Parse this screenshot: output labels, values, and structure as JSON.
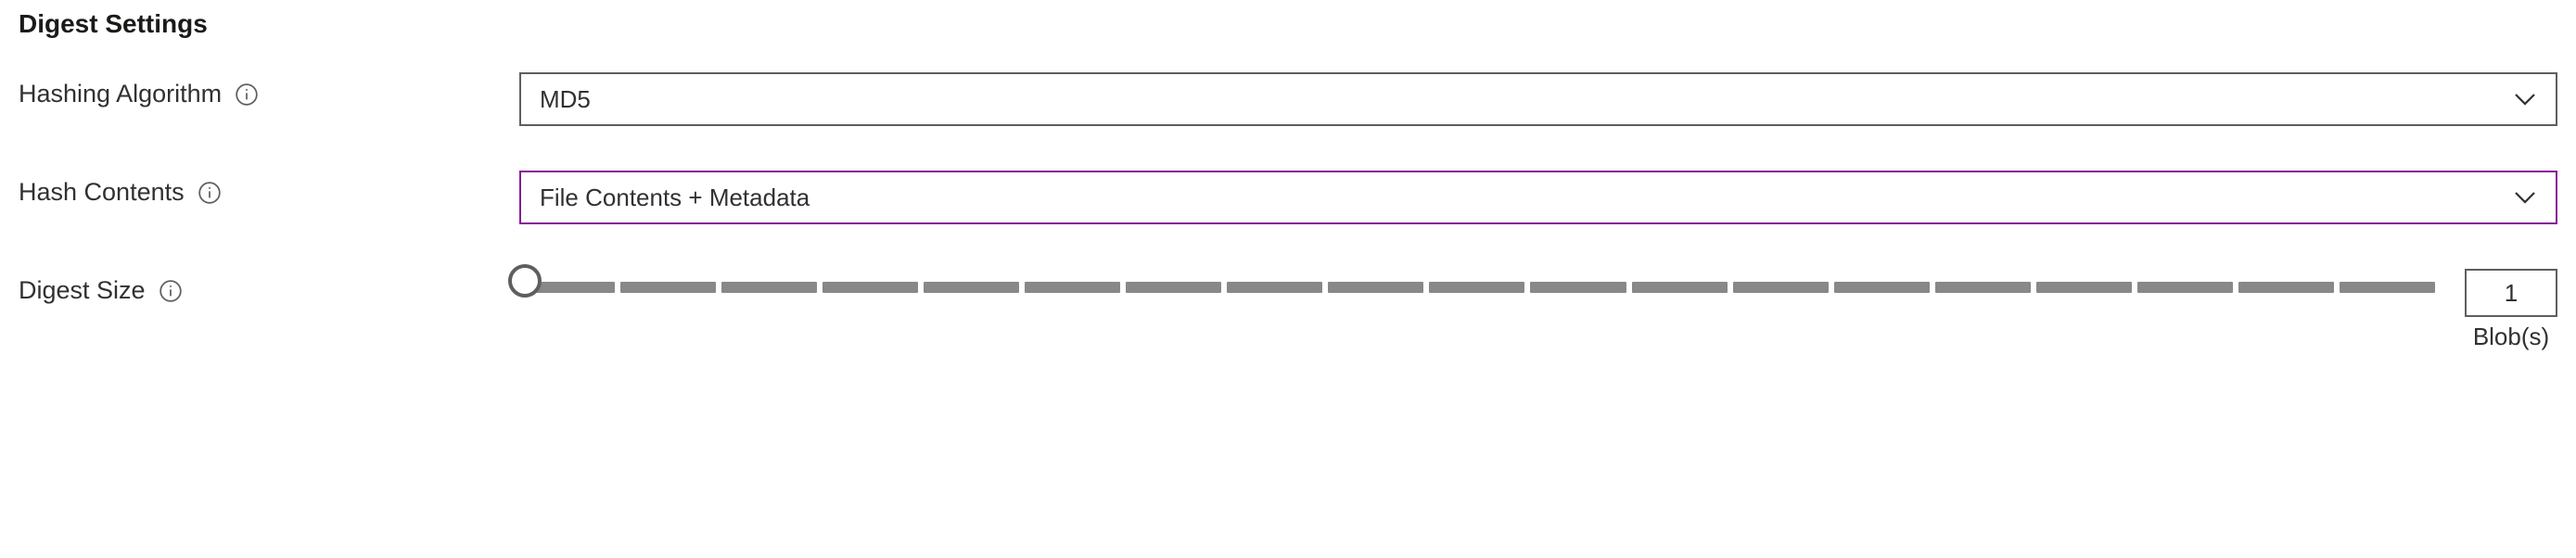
{
  "section": {
    "title": "Digest Settings"
  },
  "fields": {
    "hashingAlgorithm": {
      "label": "Hashing Algorithm",
      "value": "MD5"
    },
    "hashContents": {
      "label": "Hash Contents",
      "value": "File Contents + Metadata"
    },
    "digestSize": {
      "label": "Digest Size",
      "value": "1",
      "unit": "Blob(s)",
      "min": 1,
      "max": 20
    }
  }
}
